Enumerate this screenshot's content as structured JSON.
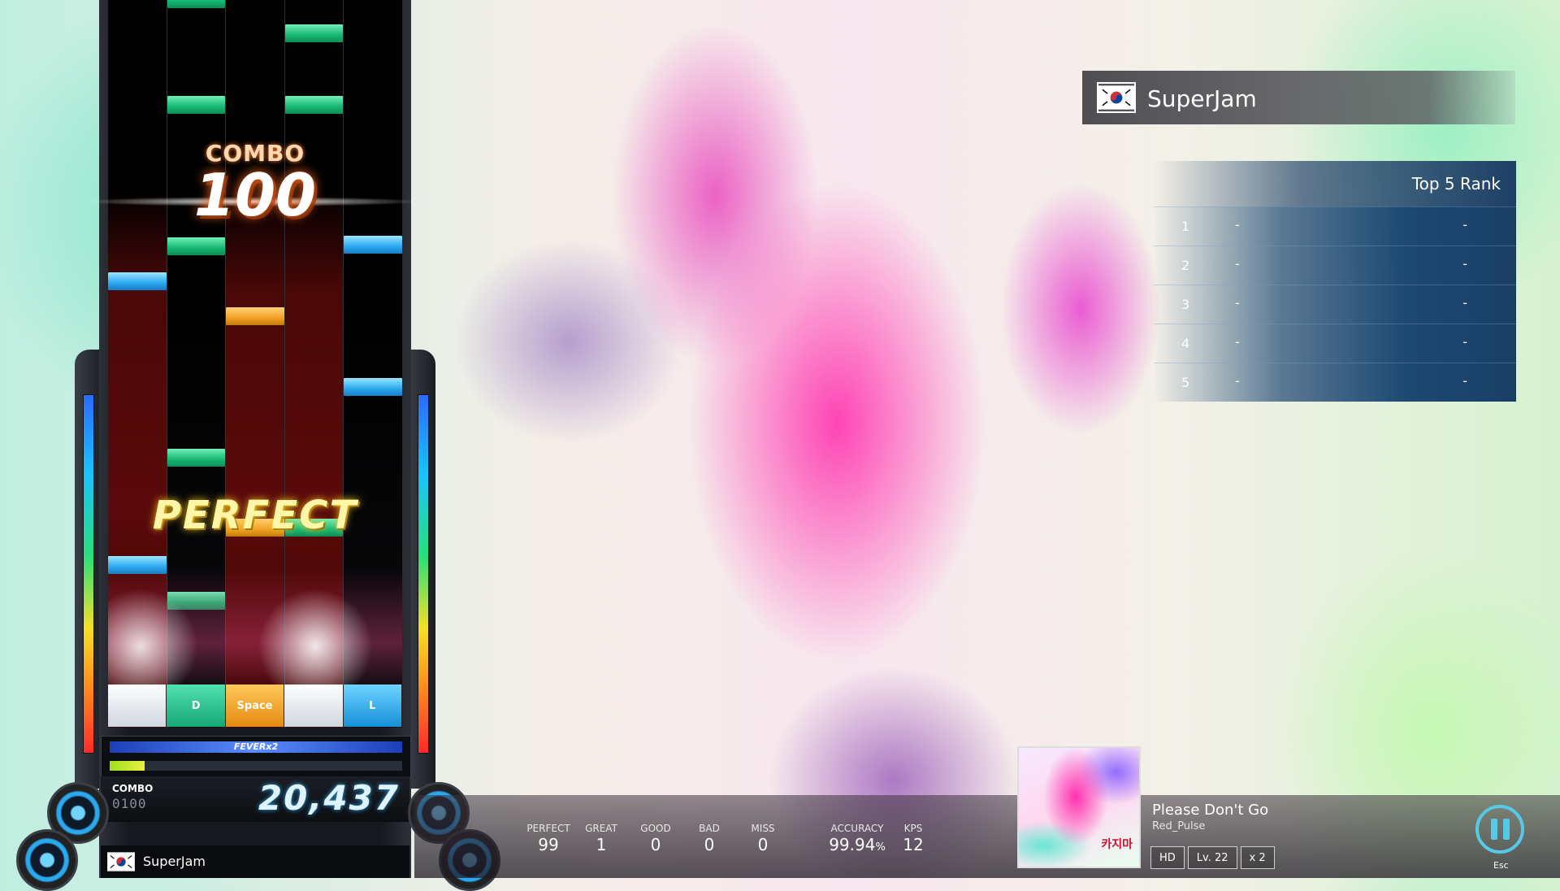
{
  "gameplay": {
    "combo_label": "COMBO",
    "combo_count": "100",
    "judgement": "PERFECT",
    "keys": [
      "",
      "D",
      "Space",
      "",
      "L"
    ],
    "fever_label": "FEVERx2",
    "fever_gauge_fraction": 0.12,
    "combo_small_label": "COMBO",
    "combo_small_value": "0100",
    "score": "20,437",
    "player_name": "SuperJam"
  },
  "player": {
    "name": "SuperJam",
    "flag": "south-korea-flag"
  },
  "ranking": {
    "title": "Top 5 Rank",
    "rows": [
      {
        "rank": "1",
        "player": "-",
        "score": "-"
      },
      {
        "rank": "2",
        "player": "-",
        "score": "-"
      },
      {
        "rank": "3",
        "player": "-",
        "score": "-"
      },
      {
        "rank": "4",
        "player": "-",
        "score": "-"
      },
      {
        "rank": "5",
        "player": "-",
        "score": "-"
      }
    ]
  },
  "stats": {
    "perfect": {
      "label": "PERFECT",
      "value": "99"
    },
    "great": {
      "label": "GREAT",
      "value": "1"
    },
    "good": {
      "label": "GOOD",
      "value": "0"
    },
    "bad": {
      "label": "BAD",
      "value": "0"
    },
    "miss": {
      "label": "MISS",
      "value": "0"
    },
    "accuracy": {
      "label": "ACCURACY",
      "value": "99.94",
      "unit": "%"
    },
    "kps": {
      "label": "KPS",
      "value": "12"
    }
  },
  "song": {
    "title": "Please Don't Go",
    "artist": "Red_Pulse",
    "jacket_text": "카지마",
    "difficulty": "HD",
    "level": "Lv. 22",
    "speed": "x 2"
  },
  "controls": {
    "pause_icon": "pause-icon",
    "esc_label": "Esc"
  },
  "colors": {
    "accent_cyan": "#56c8e8",
    "note_green": "#16b772",
    "note_blue": "#2aa9f0",
    "note_orange": "#f0a020",
    "rank_panel": "#1e3f66"
  }
}
